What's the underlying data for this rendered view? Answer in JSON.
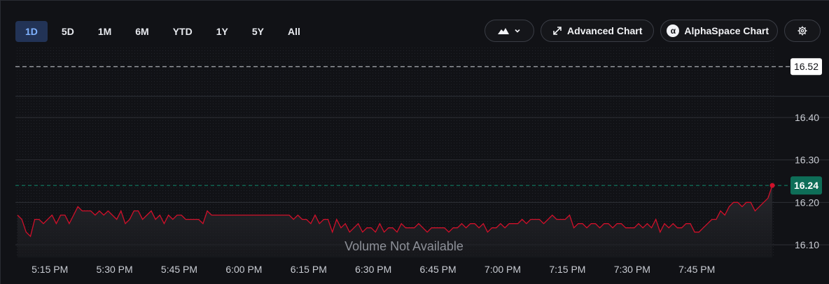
{
  "toolbar": {
    "ranges": [
      "1D",
      "5D",
      "1M",
      "6M",
      "YTD",
      "1Y",
      "5Y",
      "All"
    ],
    "active_range": "1D",
    "advanced_label": "Advanced Chart",
    "alphaspace_label": "AlphaSpace Chart",
    "chart_type_icon": "mountain-area-icon",
    "settings_icon": "gear-icon"
  },
  "colors": {
    "background": "#111216",
    "line": "#d0102a",
    "current_tag": "#0e6e58",
    "active_range": "#223356"
  },
  "chart_data": {
    "type": "line",
    "y_ticks": [
      "16.40",
      "16.30",
      "16.20",
      "16.10"
    ],
    "x_ticks": [
      "5:15 PM",
      "5:30 PM",
      "5:45 PM",
      "6:00 PM",
      "6:15 PM",
      "6:30 PM",
      "6:45 PM",
      "7:00 PM",
      "7:15 PM",
      "7:30 PM",
      "7:45 PM"
    ],
    "ylim": [
      16.07,
      16.58
    ],
    "x_range_minutes": [
      0,
      175
    ],
    "reference_high": 16.52,
    "high_label": "16.52",
    "current": 16.24,
    "current_label": "16.24",
    "empty_state": "Volume Not Available",
    "grid": true,
    "series": [
      {
        "values": [
          [
            0,
            16.17
          ],
          [
            1,
            16.16
          ],
          [
            2,
            16.13
          ],
          [
            3,
            16.12
          ],
          [
            4,
            16.16
          ],
          [
            5,
            16.16
          ],
          [
            6,
            16.15
          ],
          [
            7,
            16.16
          ],
          [
            8,
            16.17
          ],
          [
            9,
            16.15
          ],
          [
            10,
            16.17
          ],
          [
            11,
            16.17
          ],
          [
            12,
            16.15
          ],
          [
            13,
            16.17
          ],
          [
            14,
            16.19
          ],
          [
            15,
            16.18
          ],
          [
            16,
            16.18
          ],
          [
            17,
            16.18
          ],
          [
            18,
            16.17
          ],
          [
            19,
            16.18
          ],
          [
            20,
            16.17
          ],
          [
            21,
            16.18
          ],
          [
            22,
            16.17
          ],
          [
            23,
            16.16
          ],
          [
            24,
            16.18
          ],
          [
            25,
            16.15
          ],
          [
            26,
            16.16
          ],
          [
            27,
            16.18
          ],
          [
            28,
            16.18
          ],
          [
            29,
            16.16
          ],
          [
            30,
            16.17
          ],
          [
            31,
            16.18
          ],
          [
            32,
            16.16
          ],
          [
            33,
            16.17
          ],
          [
            34,
            16.15
          ],
          [
            35,
            16.17
          ],
          [
            36,
            16.16
          ],
          [
            37,
            16.17
          ],
          [
            38,
            16.17
          ],
          [
            39,
            16.16
          ],
          [
            40,
            16.16
          ],
          [
            41,
            16.16
          ],
          [
            42,
            16.16
          ],
          [
            43,
            16.15
          ],
          [
            44,
            16.18
          ],
          [
            45,
            16.17
          ],
          [
            46,
            16.17
          ],
          [
            47,
            16.17
          ],
          [
            48,
            16.17
          ],
          [
            50,
            16.17
          ],
          [
            55,
            16.17
          ],
          [
            60,
            16.17
          ],
          [
            63,
            16.17
          ],
          [
            64,
            16.16
          ],
          [
            65,
            16.17
          ],
          [
            66,
            16.16
          ],
          [
            67,
            16.16
          ],
          [
            68,
            16.15
          ],
          [
            69,
            16.17
          ],
          [
            70,
            16.15
          ],
          [
            71,
            16.16
          ],
          [
            72,
            16.16
          ],
          [
            73,
            16.13
          ],
          [
            74,
            16.16
          ],
          [
            75,
            16.14
          ],
          [
            76,
            16.15
          ],
          [
            77,
            16.13
          ],
          [
            78,
            16.14
          ],
          [
            79,
            16.15
          ],
          [
            80,
            16.13
          ],
          [
            81,
            16.14
          ],
          [
            82,
            16.14
          ],
          [
            83,
            16.13
          ],
          [
            84,
            16.15
          ],
          [
            85,
            16.13
          ],
          [
            86,
            16.14
          ],
          [
            87,
            16.14
          ],
          [
            88,
            16.13
          ],
          [
            89,
            16.15
          ],
          [
            90,
            16.14
          ],
          [
            91,
            16.14
          ],
          [
            92,
            16.14
          ],
          [
            93,
            16.15
          ],
          [
            94,
            16.14
          ],
          [
            95,
            16.13
          ],
          [
            96,
            16.14
          ],
          [
            97,
            16.14
          ],
          [
            98,
            16.14
          ],
          [
            99,
            16.14
          ],
          [
            100,
            16.13
          ],
          [
            101,
            16.14
          ],
          [
            102,
            16.14
          ],
          [
            103,
            16.15
          ],
          [
            104,
            16.14
          ],
          [
            105,
            16.15
          ],
          [
            106,
            16.15
          ],
          [
            107,
            16.14
          ],
          [
            108,
            16.15
          ],
          [
            109,
            16.13
          ],
          [
            110,
            16.14
          ],
          [
            111,
            16.14
          ],
          [
            112,
            16.15
          ],
          [
            113,
            16.14
          ],
          [
            114,
            16.15
          ],
          [
            115,
            16.15
          ],
          [
            116,
            16.15
          ],
          [
            117,
            16.16
          ],
          [
            118,
            16.15
          ],
          [
            119,
            16.16
          ],
          [
            120,
            16.16
          ],
          [
            121,
            16.16
          ],
          [
            122,
            16.15
          ],
          [
            123,
            16.16
          ],
          [
            124,
            16.17
          ],
          [
            125,
            16.16
          ],
          [
            126,
            16.16
          ],
          [
            127,
            16.16
          ],
          [
            128,
            16.17
          ],
          [
            129,
            16.14
          ],
          [
            130,
            16.15
          ],
          [
            131,
            16.15
          ],
          [
            132,
            16.14
          ],
          [
            133,
            16.15
          ],
          [
            134,
            16.15
          ],
          [
            135,
            16.14
          ],
          [
            136,
            16.15
          ],
          [
            137,
            16.15
          ],
          [
            138,
            16.14
          ],
          [
            139,
            16.15
          ],
          [
            140,
            16.15
          ],
          [
            141,
            16.14
          ],
          [
            142,
            16.14
          ],
          [
            143,
            16.14
          ],
          [
            144,
            16.15
          ],
          [
            145,
            16.14
          ],
          [
            146,
            16.15
          ],
          [
            147,
            16.14
          ],
          [
            148,
            16.16
          ],
          [
            149,
            16.13
          ],
          [
            150,
            16.15
          ],
          [
            151,
            16.14
          ],
          [
            152,
            16.15
          ],
          [
            153,
            16.14
          ],
          [
            154,
            16.14
          ],
          [
            155,
            16.15
          ],
          [
            156,
            16.15
          ],
          [
            157,
            16.13
          ],
          [
            158,
            16.13
          ],
          [
            159,
            16.14
          ],
          [
            160,
            16.15
          ],
          [
            161,
            16.16
          ],
          [
            162,
            16.16
          ],
          [
            163,
            16.18
          ],
          [
            164,
            16.17
          ],
          [
            165,
            16.19
          ],
          [
            166,
            16.2
          ],
          [
            167,
            16.2
          ],
          [
            168,
            16.19
          ],
          [
            169,
            16.2
          ],
          [
            170,
            16.2
          ],
          [
            171,
            16.18
          ],
          [
            172,
            16.19
          ],
          [
            173,
            16.2
          ],
          [
            174,
            16.21
          ],
          [
            175,
            16.24
          ]
        ]
      }
    ]
  }
}
